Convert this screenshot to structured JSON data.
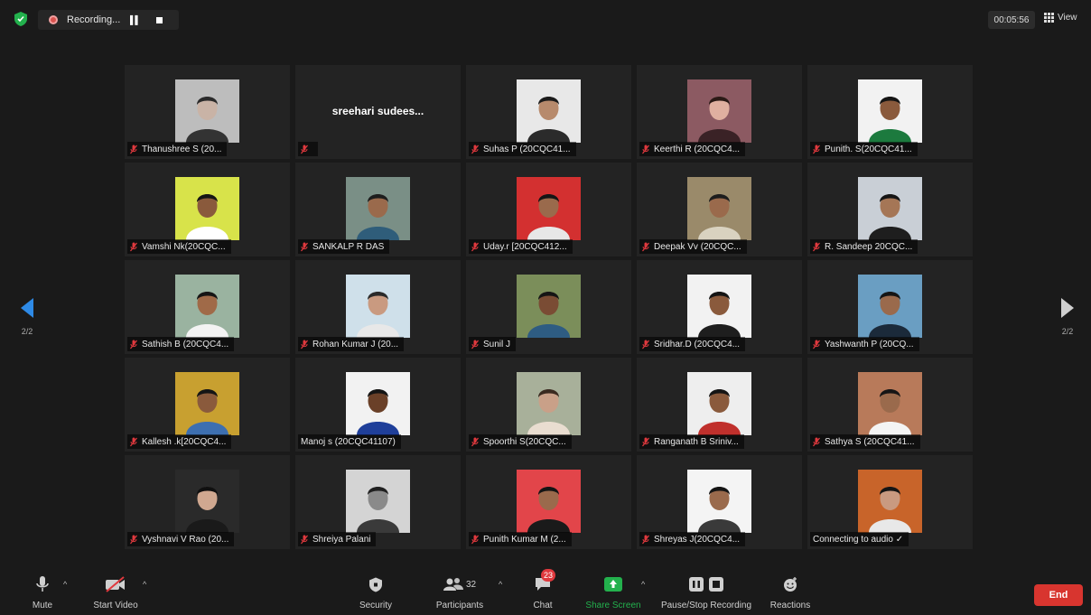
{
  "recording": {
    "status": "Recording..."
  },
  "header": {
    "timer": "00:05:56",
    "view_label": "View"
  },
  "pagination": {
    "left": "2/2",
    "right": "2/2"
  },
  "participants": [
    {
      "name": "Thanushree S  (20...",
      "muted": true,
      "bg": "#bdbdbd",
      "shirt": "#333333",
      "skin": "#c9b3a6",
      "hair": "#2a2a2a"
    },
    {
      "name": "",
      "display_name": "sreehari  sudees...",
      "muted": true,
      "no_video": true
    },
    {
      "name": "Suhas P (20CQC41...",
      "muted": true,
      "bg": "#e8e8e8",
      "shirt": "#2b2b2b",
      "skin": "#b78a6c",
      "hair": "#1b1b1b"
    },
    {
      "name": "Keerthi R (20CQC4...",
      "muted": true,
      "bg": "#8c5a62",
      "shirt": "#3a2226",
      "skin": "#e0b0a0",
      "hair": "#2b1a16"
    },
    {
      "name": "Punith. S(20CQC41...",
      "muted": true,
      "bg": "#f2f2f2",
      "shirt": "#1c7a3e",
      "skin": "#8a5a3c",
      "hair": "#151515"
    },
    {
      "name": "Vamshi Nk(20CQC...",
      "muted": true,
      "bg": "#d8e34a",
      "shirt": "#ffffff",
      "skin": "#8a5a3c",
      "hair": "#151515"
    },
    {
      "name": "SANKALP R DAS",
      "muted": true,
      "bg": "#7a8f86",
      "shirt": "#2f5d7a",
      "skin": "#9a6a4c",
      "hair": "#1d1d1d"
    },
    {
      "name": "Uday.r [20CQC412...",
      "muted": true,
      "bg": "#d33030",
      "shirt": "#e7e7e7",
      "skin": "#9a6a4c",
      "hair": "#151515"
    },
    {
      "name": "Deepak Vv (20CQC...",
      "muted": true,
      "bg": "#9a8a6a",
      "shirt": "#d9d2c0",
      "skin": "#9a6a4c",
      "hair": "#1d1d1d"
    },
    {
      "name": "R. Sandeep 20CQC...",
      "muted": true,
      "bg": "#c9cfd6",
      "shirt": "#1e1e1e",
      "skin": "#a57656",
      "hair": "#151515"
    },
    {
      "name": "Sathish B (20CQC4...",
      "muted": true,
      "bg": "#9ab3a0",
      "shirt": "#f3f3f3",
      "skin": "#a06a48",
      "hair": "#151515"
    },
    {
      "name": "Rohan Kumar J (20...",
      "muted": true,
      "bg": "#cfe0ea",
      "shirt": "#e8e8e8",
      "skin": "#c99a80",
      "hair": "#2a2a2a"
    },
    {
      "name": "Sunil J",
      "muted": true,
      "bg": "#7b8e5a",
      "shirt": "#2e5c82",
      "skin": "#7a4c34",
      "hair": "#151515"
    },
    {
      "name": "Sridhar.D (20CQC4...",
      "muted": true,
      "bg": "#f2f2f2",
      "shirt": "#1e1e1e",
      "skin": "#8a5a3c",
      "hair": "#151515"
    },
    {
      "name": "Yashwanth P (20CQ...",
      "muted": true,
      "bg": "#6a9ec2",
      "shirt": "#1b2a3a",
      "skin": "#9a6a4c",
      "hair": "#151515"
    },
    {
      "name": "Kallesh .k[20CQC4...",
      "muted": true,
      "bg": "#c8a030",
      "shirt": "#3d6fb0",
      "skin": "#8a5a3c",
      "hair": "#151515"
    },
    {
      "name": "Manoj s (20CQC41107)",
      "muted": false,
      "bg": "#f2f2f2",
      "shirt": "#1f3f9a",
      "skin": "#6a4028",
      "hair": "#151515"
    },
    {
      "name": "Spoorthi S(20CQC...",
      "muted": true,
      "bg": "#a8b09a",
      "shirt": "#e9ddd0",
      "skin": "#c9a088",
      "hair": "#3a2a20"
    },
    {
      "name": "Ranganath B Sriniv...",
      "muted": true,
      "bg": "#eeeeee",
      "shirt": "#c0302c",
      "skin": "#8a5a3c",
      "hair": "#151515"
    },
    {
      "name": "Sathya S (20CQC41...",
      "muted": true,
      "bg": "#b87a5a",
      "shirt": "#f4f4f4",
      "skin": "#9a6a4c",
      "hair": "#151515"
    },
    {
      "name": "Vyshnavi V Rao (20...",
      "muted": true,
      "bg": "#2a2a2a",
      "shirt": "#1a1a1a",
      "skin": "#d0a890",
      "hair": "#101010"
    },
    {
      "name": "Shreiya Palani",
      "muted": true,
      "bg": "#d4d4d4",
      "shirt": "#3a3a3a",
      "skin": "#8a8a8a",
      "hair": "#202020"
    },
    {
      "name": "Punith Kumar M (2...",
      "muted": true,
      "bg": "#e2454a",
      "shirt": "#1a1a1a",
      "skin": "#9a6a4c",
      "hair": "#151515"
    },
    {
      "name": "Shreyas J(20CQC4...",
      "muted": true,
      "bg": "#f4f4f4",
      "shirt": "#3a3a3a",
      "skin": "#9a6a4c",
      "hair": "#151515"
    },
    {
      "name": "Connecting to audio ✓",
      "muted": false,
      "bg": "#c8642a",
      "shirt": "#e8e8e8",
      "skin": "#c99a80",
      "hair": "#151515"
    }
  ],
  "toolbar": {
    "mute": "Mute",
    "start_video": "Start Video",
    "security": "Security",
    "participants": "Participants",
    "participants_count": "32",
    "chat": "Chat",
    "chat_badge": "23",
    "share_screen": "Share Screen",
    "pause_stop": "Pause/Stop Recording",
    "reactions": "Reactions",
    "end": "End"
  },
  "colors": {
    "accent_blue": "#2e8ae6",
    "share_green": "#23b14d",
    "end_red": "#d8352f",
    "mute_red": "#e0393e"
  }
}
